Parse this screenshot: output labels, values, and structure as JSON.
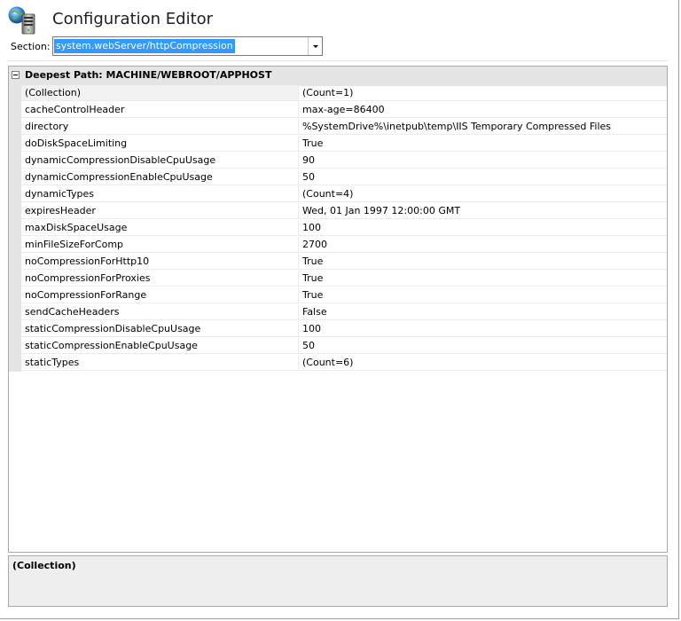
{
  "header": {
    "title": "Configuration Editor",
    "icon": "globe-server-icon"
  },
  "section": {
    "label": "Section:",
    "value": "system.webServer/httpCompression"
  },
  "grid": {
    "header_label": "Deepest Path: MACHINE/WEBROOT/APPHOST",
    "rows": [
      {
        "name": "(Collection)",
        "value": "(Count=1)"
      },
      {
        "name": "cacheControlHeader",
        "value": "max-age=86400"
      },
      {
        "name": "directory",
        "value": "%SystemDrive%\\inetpub\\temp\\IIS Temporary Compressed Files"
      },
      {
        "name": "doDiskSpaceLimiting",
        "value": "True"
      },
      {
        "name": "dynamicCompressionDisableCpuUsage",
        "value": "90"
      },
      {
        "name": "dynamicCompressionEnableCpuUsage",
        "value": "50"
      },
      {
        "name": "dynamicTypes",
        "value": "(Count=4)"
      },
      {
        "name": "expiresHeader",
        "value": "Wed, 01 Jan 1997 12:00:00 GMT"
      },
      {
        "name": "maxDiskSpaceUsage",
        "value": "100"
      },
      {
        "name": "minFileSizeForComp",
        "value": "2700"
      },
      {
        "name": "noCompressionForHttp10",
        "value": "True"
      },
      {
        "name": "noCompressionForProxies",
        "value": "True"
      },
      {
        "name": "noCompressionForRange",
        "value": "True"
      },
      {
        "name": "sendCacheHeaders",
        "value": "False"
      },
      {
        "name": "staticCompressionDisableCpuUsage",
        "value": "100"
      },
      {
        "name": "staticCompressionEnableCpuUsage",
        "value": "50"
      },
      {
        "name": "staticTypes",
        "value": "(Count=6)"
      }
    ]
  },
  "description": {
    "title": "(Collection)"
  },
  "colors": {
    "selection": "#3399ff",
    "grid_header": "#e5e5e5",
    "description_bg": "#eeeeee"
  }
}
